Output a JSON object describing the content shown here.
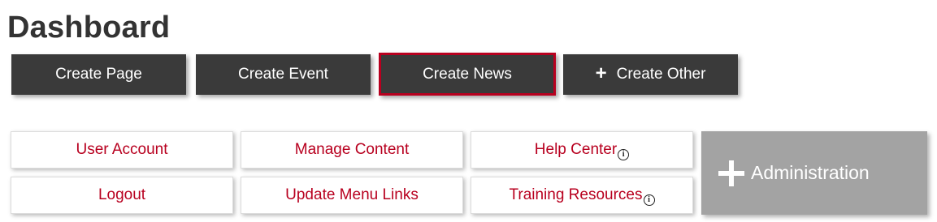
{
  "page_title": "Dashboard",
  "create_buttons": [
    {
      "label": "Create Page"
    },
    {
      "label": "Create Event"
    },
    {
      "label": "Create News",
      "active": true
    },
    {
      "label": "Create Other",
      "icon": "plus-icon"
    }
  ],
  "links": [
    {
      "label": "User Account"
    },
    {
      "label": "Manage Content"
    },
    {
      "label": "Help Center",
      "icon": "info-icon"
    },
    {
      "label": "Logout"
    },
    {
      "label": "Update Menu Links"
    },
    {
      "label": "Training Resources",
      "icon": "info-icon"
    }
  ],
  "info_glyph": "i",
  "admin": {
    "label": "Administration",
    "icon": "plus-icon"
  },
  "colors": {
    "accent": "#b8001f",
    "button_dark": "#3a3a3a",
    "admin_gray": "#a3a3a3",
    "title": "#333333"
  }
}
